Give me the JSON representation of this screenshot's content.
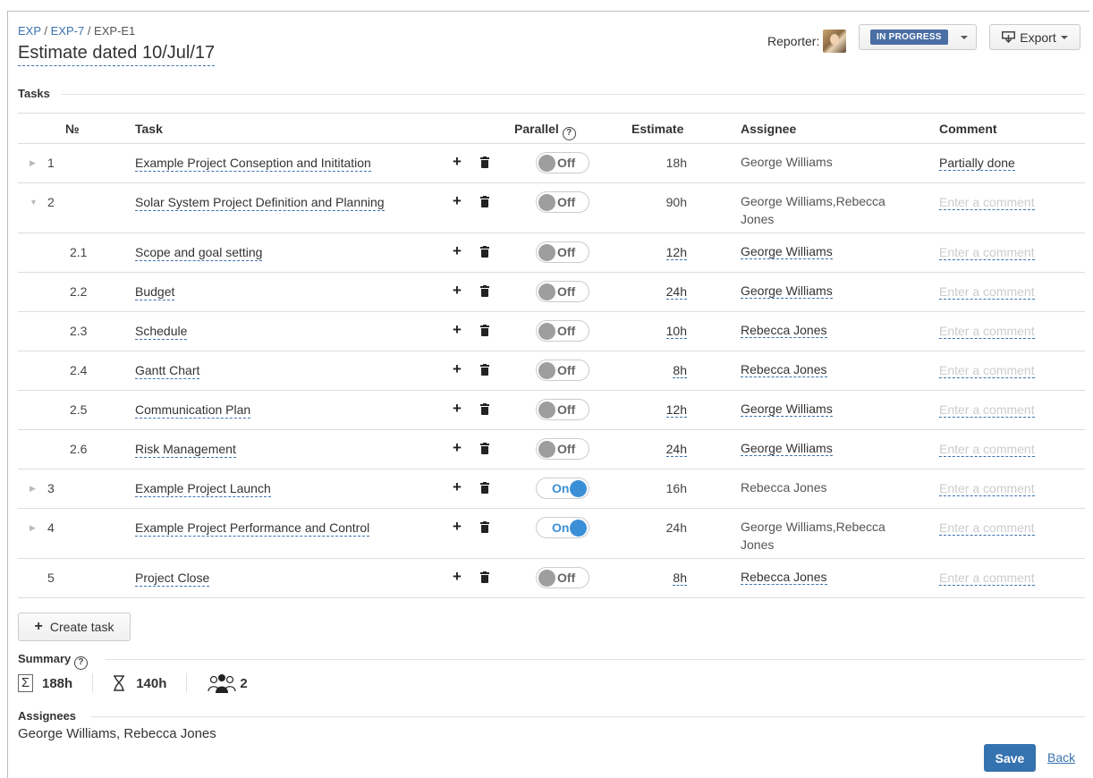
{
  "breadcrumb": {
    "items": [
      "EXP",
      "EXP-7",
      "EXP-E1"
    ],
    "sep": " / "
  },
  "page_title": "Estimate dated 10/Jul/17",
  "reporter_label": "Reporter:",
  "status": {
    "label": "IN PROGRESS"
  },
  "export_label": "Export",
  "sections": {
    "tasks": "Tasks",
    "summary": "Summary",
    "assignees": "Assignees"
  },
  "table": {
    "headers": {
      "num": "№",
      "task": "Task",
      "parallel": "Parallel",
      "estimate": "Estimate",
      "assignee": "Assignee",
      "comment": "Comment"
    },
    "comment_placeholder": "Enter a comment",
    "rows": [
      {
        "num": "1",
        "task": "Example Project Conseption and Inititation",
        "parallel": "Off",
        "estimate": "18h",
        "assignee": "George Williams",
        "assignee2": "",
        "comment": "Partially done"
      },
      {
        "num": "2",
        "task": "Solar System Project Definition and Planning",
        "parallel": "Off",
        "estimate": "90h",
        "assignee": "George Williams,Rebecca",
        "assignee2": "Jones",
        "comment": ""
      },
      {
        "num": "2.1",
        "task": "Scope and goal setting",
        "parallel": "Off",
        "estimate": "12h",
        "assignee": "George Williams",
        "assignee2": "",
        "comment": ""
      },
      {
        "num": "2.2",
        "task": "Budget",
        "parallel": "Off",
        "estimate": "24h",
        "assignee": "George Williams",
        "assignee2": "",
        "comment": ""
      },
      {
        "num": "2.3",
        "task": "Schedule",
        "parallel": "Off",
        "estimate": "10h",
        "assignee": "Rebecca Jones",
        "assignee2": "",
        "comment": ""
      },
      {
        "num": "2.4",
        "task": "Gantt Chart",
        "parallel": "Off",
        "estimate": "8h",
        "assignee": "Rebecca Jones",
        "assignee2": "",
        "comment": ""
      },
      {
        "num": "2.5",
        "task": "Communication Plan",
        "parallel": "Off",
        "estimate": "12h",
        "assignee": "George Williams",
        "assignee2": "",
        "comment": ""
      },
      {
        "num": "2.6",
        "task": "Risk Management",
        "parallel": "Off",
        "estimate": "24h",
        "assignee": "George Williams",
        "assignee2": "",
        "comment": ""
      },
      {
        "num": "3",
        "task": "Example Project Launch",
        "parallel": "On",
        "estimate": "16h",
        "assignee": "Rebecca Jones",
        "assignee2": "",
        "comment": ""
      },
      {
        "num": "4",
        "task": "Example Project Performance and Control",
        "parallel": "On",
        "estimate": "24h",
        "assignee": "George Williams,Rebecca",
        "assignee2": "Jones",
        "comment": ""
      },
      {
        "num": "5",
        "task": "Project Close",
        "parallel": "Off",
        "estimate": "8h",
        "assignee": "Rebecca Jones",
        "assignee2": "",
        "comment": ""
      }
    ]
  },
  "create_task_label": "Create task",
  "summary": {
    "total": "188h",
    "duration": "140h",
    "people": "2"
  },
  "assignees_list": "George Williams, Rebecca Jones",
  "save_label": "Save",
  "back_label": "Back"
}
